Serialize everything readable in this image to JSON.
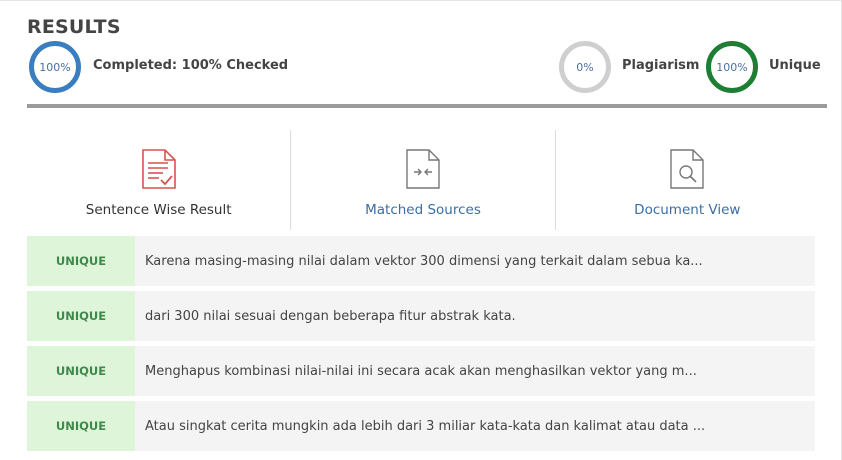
{
  "results": {
    "title": "RESULTS",
    "completed_percent": "100%",
    "completed_label": "Completed: 100% Checked",
    "plagiarism_percent": "0%",
    "plagiarism_label": "Plagiarism",
    "unique_percent": "100%",
    "unique_label": "Unique"
  },
  "nav": {
    "items": [
      {
        "label": "Sentence Wise Result",
        "icon": "document-check-icon"
      },
      {
        "label": "Matched Sources",
        "icon": "compare-document-icon"
      },
      {
        "label": "Document View",
        "icon": "document-search-icon"
      }
    ]
  },
  "rows": [
    {
      "status": "UNIQUE",
      "text": "Karena masing-masing nilai dalam vektor 300 dimensi yang terkait dalam sebua ka..."
    },
    {
      "status": "UNIQUE",
      "text": "dari 300 nilai sesuai dengan beberapa fitur abstrak kata."
    },
    {
      "status": "UNIQUE",
      "text": "Menghapus kombinasi nilai-nilai ini secara acak akan menghasilkan vektor yang m..."
    },
    {
      "status": "UNIQUE",
      "text": "Atau singkat cerita mungkin ada lebih dari 3 miliar kata-kata dan kalimat atau data ..."
    }
  ],
  "colors": {
    "completed_ring": "#3a7ebf",
    "plagiarism_ring": "#cfcfcf",
    "unique_ring": "#1e7e34",
    "unique_badge_bg": "#dff5da",
    "link": "#3a6ea5"
  }
}
